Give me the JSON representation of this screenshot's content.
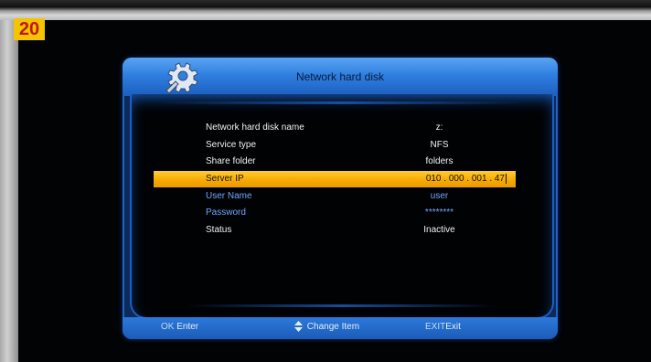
{
  "step_badge": "20",
  "dialog": {
    "title": "Network hard disk",
    "rows": [
      {
        "label": "Network hard disk name",
        "value": "z:"
      },
      {
        "label": "Service type",
        "value": "NFS"
      },
      {
        "label": "Share folder",
        "value": "folders"
      },
      {
        "label": "Server IP",
        "value": "010 . 000 . 001 . 47"
      },
      {
        "label": "User Name",
        "value": "user"
      },
      {
        "label": "Password",
        "value": "********"
      },
      {
        "label": "Status",
        "value": "Inactive"
      }
    ],
    "selected_row": "Server IP"
  },
  "footer": {
    "ok_key": "OK",
    "ok_label": "Enter",
    "change_label": "Change Item",
    "exit_key": "EXIT",
    "exit_label": "Exit"
  },
  "colors": {
    "highlight": "#f5a800",
    "dialog_blue": "#2f7fe0",
    "disabled_text": "#6fa8ff"
  },
  "icons": [
    "settings-gear-icon",
    "up-down-arrow-icon"
  ]
}
